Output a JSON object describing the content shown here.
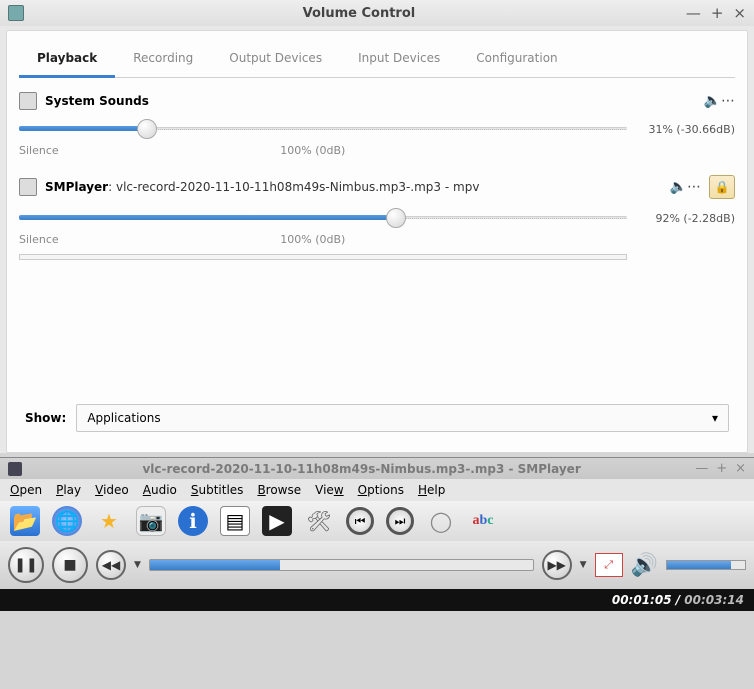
{
  "volume_control": {
    "title": "Volume Control",
    "tabs": [
      {
        "label": "Playback",
        "active": true
      },
      {
        "label": "Recording",
        "active": false
      },
      {
        "label": "Output Devices",
        "active": false
      },
      {
        "label": "Input Devices",
        "active": false
      },
      {
        "label": "Configuration",
        "active": false
      }
    ],
    "streams": [
      {
        "name": "System Sounds",
        "subtitle": "",
        "percent": 31,
        "readout": "31% (-30.66dB)",
        "slider_fill_pct": 21,
        "labels": {
          "left": "Silence",
          "mid": "100% (0dB)"
        },
        "has_lock": false
      },
      {
        "name": "SMPlayer",
        "subtitle": ": vlc-record-2020-11-10-11h08m49s-Nimbus.mp3-.mp3 - mpv",
        "percent": 92,
        "readout": "92% (-2.28dB)",
        "slider_fill_pct": 62,
        "labels": {
          "left": "Silence",
          "mid": "100% (0dB)"
        },
        "has_lock": true
      }
    ],
    "show": {
      "label": "Show:",
      "value": "Applications"
    }
  },
  "smplayer": {
    "title": "vlc-record-2020-11-10-11h08m49s-Nimbus.mp3-.mp3 - SMPlayer",
    "menu": [
      "Open",
      "Play",
      "Video",
      "Audio",
      "Subtitles",
      "Browse",
      "View",
      "Options",
      "Help"
    ],
    "seek_pct": 34,
    "volume_pct": 82,
    "time": {
      "current": "00:01:05",
      "total": "00:03:14"
    }
  }
}
